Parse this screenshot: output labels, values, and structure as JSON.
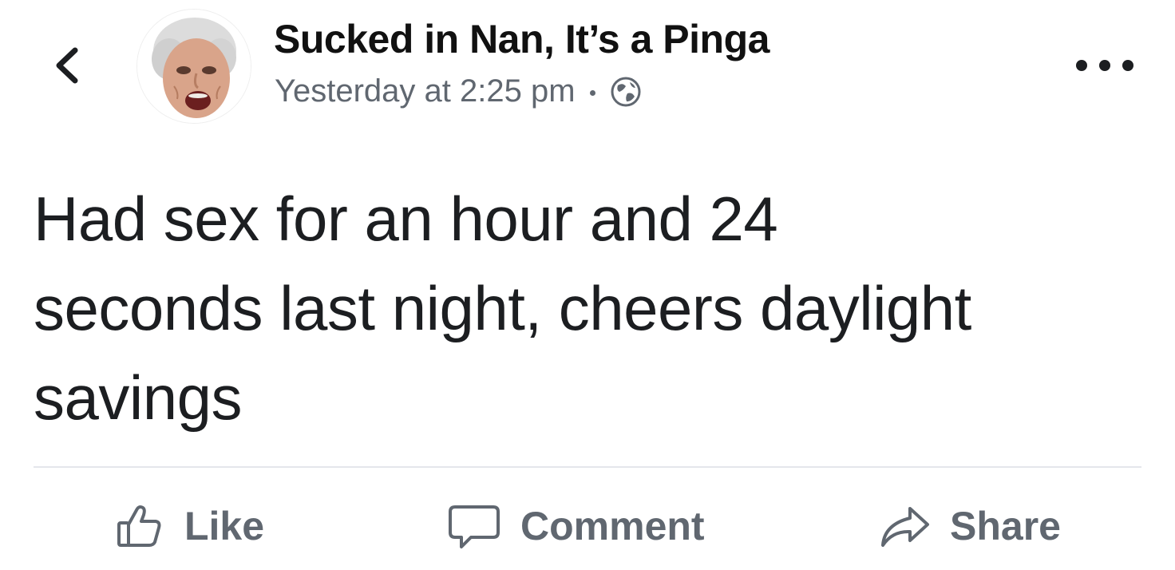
{
  "post": {
    "author": "Sucked in Nan, It’s a Pinga",
    "timestamp": "Yesterday at 2:25 pm",
    "audience_icon": "globe-icon",
    "text": "Had sex for an hour and 24 seconds last night, cheers daylight savings"
  },
  "actions": {
    "like": "Like",
    "comment": "Comment",
    "share": "Share"
  },
  "icons": {
    "back": "chevron-left-icon",
    "more": "more-options-icon",
    "like": "thumbs-up-icon",
    "comment": "comment-bubble-icon",
    "share": "share-arrow-icon"
  },
  "colors": {
    "text": "#1c1e21",
    "secondary_text": "#606770",
    "divider": "#e4e6eb",
    "background": "#ffffff"
  }
}
